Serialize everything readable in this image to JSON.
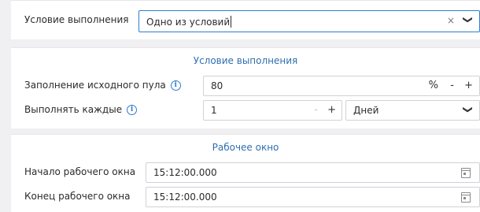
{
  "top": {
    "label": "Условие выполнения",
    "select_value": "Одно из условий",
    "clear_symbol": "×",
    "dropdown_symbol": "❯"
  },
  "condition_section": {
    "title": "Условие выполнения",
    "pool_fill": {
      "label": "Заполнение исходного пула",
      "value": "80",
      "unit": "%",
      "minus": "-",
      "plus": "+"
    },
    "run_every": {
      "label": "Выполнять каждые",
      "value": "1",
      "minus": "-",
      "plus": "+",
      "period_value": "Дней"
    },
    "info_symbol": "i"
  },
  "work_window": {
    "title": "Рабочее окно",
    "start": {
      "label": "Начало рабочего окна",
      "value": "15:12:00.000"
    },
    "end": {
      "label": "Конец рабочего окна",
      "value": "15:12:00.000"
    }
  }
}
